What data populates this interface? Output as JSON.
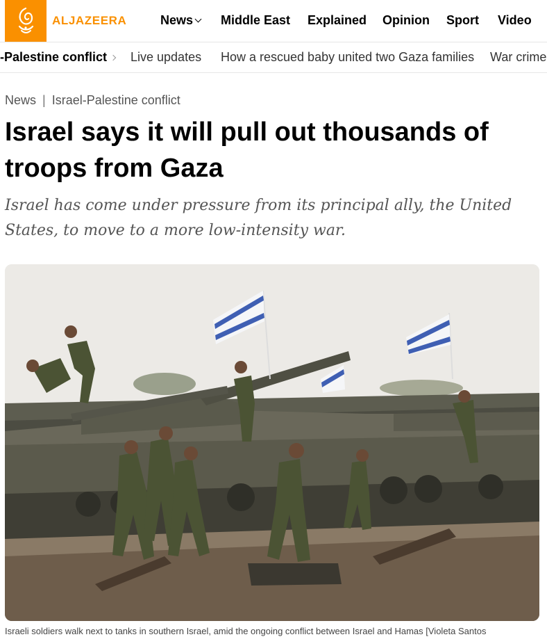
{
  "brand": {
    "name": "ALJAZEERA",
    "color": "#fa9000"
  },
  "main_nav": [
    {
      "label": "News",
      "has_dropdown": true
    },
    {
      "label": "Middle East"
    },
    {
      "label": "Explained"
    },
    {
      "label": "Opinion"
    },
    {
      "label": "Sport"
    },
    {
      "label": "Video"
    }
  ],
  "sub_nav": [
    {
      "label": "-Palestine conflict",
      "active": true
    },
    {
      "label": "Live updates"
    },
    {
      "label": "How a rescued baby united two Gaza families"
    },
    {
      "label": "War crimes"
    }
  ],
  "breadcrumb": {
    "section": "News",
    "topic": "Israel-Palestine conflict"
  },
  "article": {
    "headline": "Israel says it will pull out thousands of troops from Gaza",
    "standfirst": "Israel has come under pressure from its principal ally, the United States, to move to a more low-intensity war.",
    "image_alt": "Israeli soldiers walk next to tanks in southern Israel",
    "caption": "Israeli soldiers walk next to tanks in southern Israel, amid the ongoing conflict between Israel and Hamas [Violeta Santos"
  }
}
